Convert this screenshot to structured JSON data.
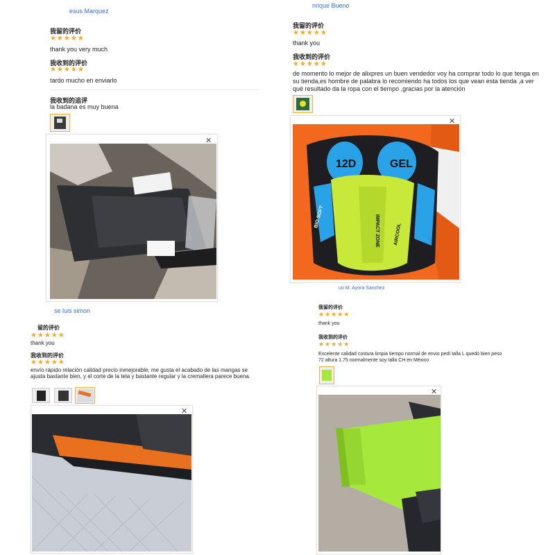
{
  "colors": {
    "star": "#f5a623",
    "reviewer": "#3a6fc4",
    "thumb_border": "#f0b33a"
  },
  "icons": {
    "stars": "five-star-rating-icon",
    "close": "close-icon"
  },
  "reviews": [
    {
      "reviewer": "esus Marquez",
      "sections": [
        {
          "label": "我留的评价",
          "stars": "★★★★★",
          "text": "thank you very much"
        },
        {
          "label": "我收到的评价",
          "stars": "★★★★★",
          "text": "tardo mucho en enviarlo"
        },
        {
          "label": "我收到的追评",
          "stars": "",
          "text": "la badana es muy buena"
        }
      ],
      "close": "✕"
    },
    {
      "reviewer": "nrique Bueno",
      "sections": [
        {
          "label": "我留的评价",
          "stars": "★★★★★",
          "text": "thank you"
        },
        {
          "label": "我收到的评价",
          "stars": "★★★★★",
          "text": "de momento lo mejor de alixpres un buen vendedor voy ha comprar todo lo que tenga en su tienda,es hombre de palabra lo recomiendo ha todos los que vean esta tienda ,a ver qué resultado da la ropa con el tiempo ,gracias por la atención"
        }
      ],
      "close": "✕",
      "pad_text": [
        "12D",
        "GEL",
        "IMPACT ZONE",
        "AIRCOOL",
        "BIO SOFT"
      ]
    },
    {
      "reviewer": "se luis simon",
      "sections": [
        {
          "label": "留的评价",
          "stars": "★★★★★",
          "text": "thank you"
        },
        {
          "label": "我收到的评价",
          "stars": "★★★★★",
          "text": "envío rápido relación calidad precio inmejorable, me gusta el acabado de las mangas se ajusta bastante bien, y el corte de la tela y bastante regular y la cremallera parece buena."
        }
      ],
      "close": "✕"
    },
    {
      "reviewer": "uo M. Ayora Sanchez",
      "sections": [
        {
          "label": "我留的评价",
          "stars": "★★★★★",
          "text": "thank you"
        },
        {
          "label": "我收到的评价",
          "stars": "★★★★★",
          "text": "Excelente calidad costura limpia tiempo normal de envio pedí talla L quedó bien peso 72 altura 1.75 normalmente soy talla CH en México"
        }
      ],
      "close": "✕"
    }
  ]
}
